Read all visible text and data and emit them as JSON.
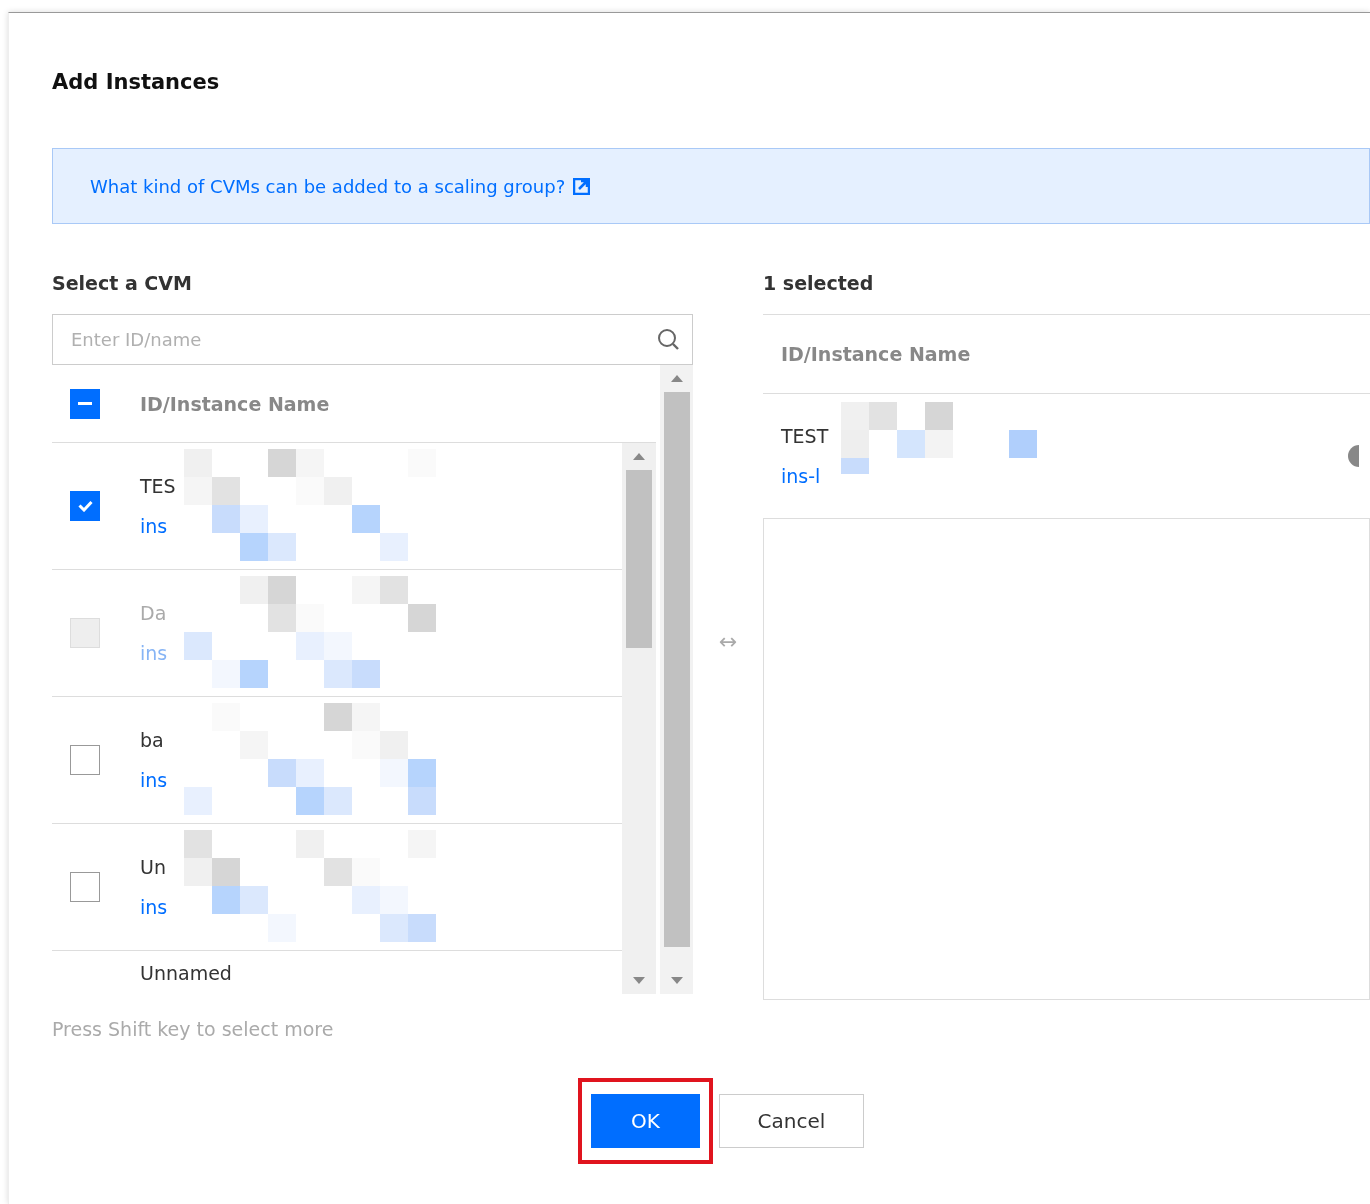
{
  "dialog": {
    "title": "Add Instances",
    "info_link": "What kind of CVMs can be added to a scaling group?",
    "source": {
      "heading": "Select a CVM",
      "search": {
        "placeholder": "Enter ID/name"
      },
      "column": "ID/Instance Name",
      "header_checkbox": {
        "indeterminate": true
      },
      "rows": [
        {
          "name": "TES",
          "id": "ins",
          "checked": true,
          "disabled": false
        },
        {
          "name": "Da",
          "id": "ins",
          "checked": false,
          "disabled": true
        },
        {
          "name": "ba",
          "id": "ins",
          "checked": false,
          "disabled": false
        },
        {
          "name": "Un",
          "id": "ins",
          "checked": false,
          "disabled": false
        },
        {
          "name": "Unnamed"
        }
      ]
    },
    "transfer_icon": "↔",
    "target": {
      "heading": "1 selected",
      "column": "ID/Instance Name",
      "rows": [
        {
          "name": "TEST",
          "id": "ins-l"
        }
      ]
    },
    "hint": "Press Shift key to select more",
    "buttons": [
      {
        "label": "OK",
        "kind": "primary",
        "highlighted": true
      },
      {
        "label": "Cancel",
        "kind": "default",
        "highlighted": false
      }
    ]
  }
}
